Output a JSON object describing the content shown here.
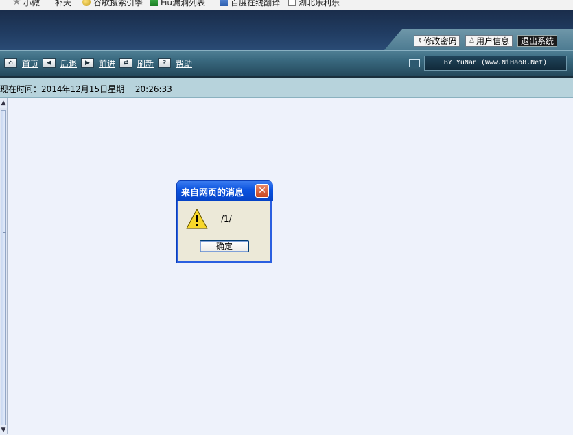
{
  "bookmarks": [
    {
      "label": "小微",
      "icon": "star-icon"
    },
    {
      "label": "补天",
      "icon": ""
    },
    {
      "label": "谷歌搜索引擎",
      "icon": "gold-globe-icon"
    },
    {
      "label": "Fiu漏洞列表",
      "icon": "green-flag-icon"
    },
    {
      "label": "百度在线翻译",
      "icon": "blue-page-icon"
    },
    {
      "label": "湖北乐利乐",
      "icon": "blank-page-icon"
    }
  ],
  "header": {
    "change_password": "修改密码",
    "user_info": "用户信息",
    "logout": "退出系统"
  },
  "toolbar": {
    "items": [
      {
        "label": "首页",
        "icon": "home-icon"
      },
      {
        "label": "后退",
        "icon": "arrow-left-icon"
      },
      {
        "label": "前进",
        "icon": "arrow-right-icon"
      },
      {
        "label": "刷新",
        "icon": "refresh-icon"
      },
      {
        "label": "帮助",
        "icon": "help-icon"
      }
    ],
    "credit": "BY YuNan (Www.NiHao8.Net)"
  },
  "timebar": {
    "text": "现在时间：2014年12月15日星期一 20:26:33"
  },
  "dialog": {
    "title": "来自网页的消息",
    "message": "/1/",
    "ok_label": "确定",
    "close_glyph": "✕"
  },
  "colors": {
    "header_dark": "#1a2d4b",
    "toolbar": "#3a6a80",
    "timebar": "#b7d3dc",
    "content_bg": "#eef2fb",
    "dialog_title": "#0a52df"
  }
}
